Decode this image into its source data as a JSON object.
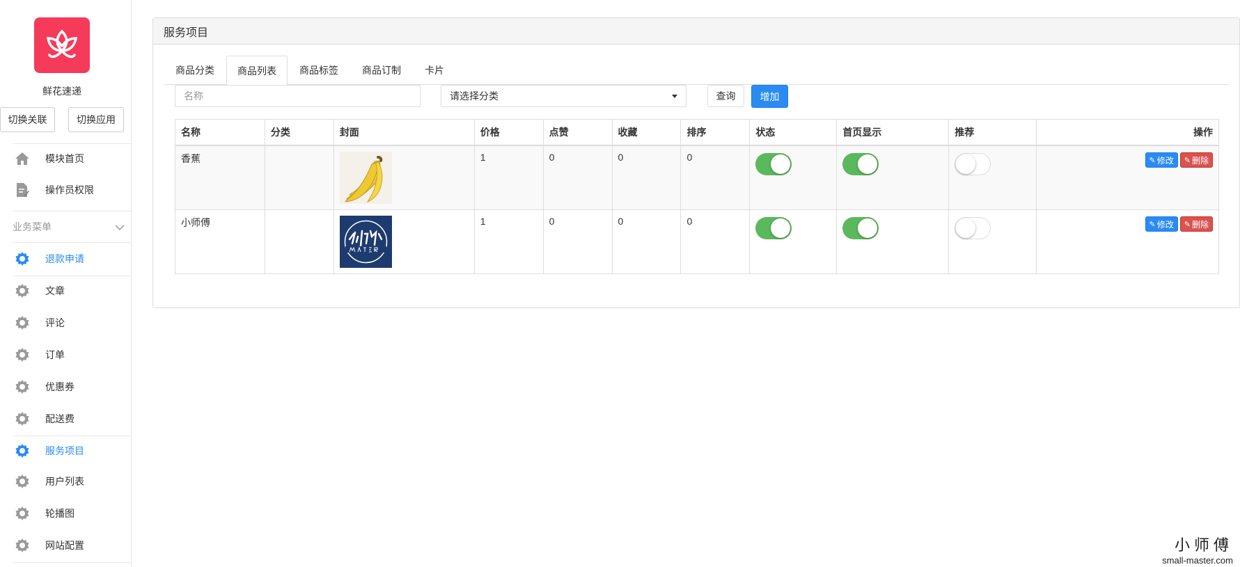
{
  "app": {
    "name": "鲜花速递",
    "switch_link": "切换关联",
    "switch_app": "切换应用",
    "brand_color": "#f53a5a"
  },
  "nav": {
    "home": "模块首页",
    "permissions": "操作员权限",
    "group_title": "业务菜单",
    "items": [
      {
        "label": "退款申请",
        "active": true
      },
      {
        "label": "文章",
        "active": false
      },
      {
        "label": "评论",
        "active": false
      },
      {
        "label": "订单",
        "active": false
      },
      {
        "label": "优惠券",
        "active": false
      },
      {
        "label": "配送费",
        "active": false
      },
      {
        "label": "服务项目",
        "active": true
      },
      {
        "label": "用户列表",
        "active": false
      },
      {
        "label": "轮播图",
        "active": false
      },
      {
        "label": "网站配置",
        "active": false
      }
    ]
  },
  "panel": {
    "title": "服务项目",
    "tabs": [
      "商品分类",
      "商品列表",
      "商品标签",
      "商品订制",
      "卡片"
    ],
    "active_tab": "商品列表"
  },
  "filters": {
    "name_placeholder": "名称",
    "category_value": "请选择分类",
    "query_label": "查询",
    "add_label": "增加"
  },
  "table": {
    "columns": [
      "名称",
      "分类",
      "封面",
      "价格",
      "点赞",
      "收藏",
      "排序",
      "状态",
      "首页显示",
      "推荐",
      "操作"
    ],
    "rows": [
      {
        "name": "香蕉",
        "category": "",
        "cover": "banana",
        "price": "1",
        "likes": "0",
        "favorites": "0",
        "sort": "0",
        "status": true,
        "home_display": true,
        "recommend": false
      },
      {
        "name": "小师傅",
        "category": "",
        "cover": "logo-master",
        "price": "1",
        "likes": "0",
        "favorites": "0",
        "sort": "0",
        "status": true,
        "home_display": true,
        "recommend": false
      }
    ],
    "edit_label": "修改",
    "delete_label": "删除"
  },
  "watermark": {
    "logo_text": "小师傅",
    "url": "small-master.com"
  }
}
